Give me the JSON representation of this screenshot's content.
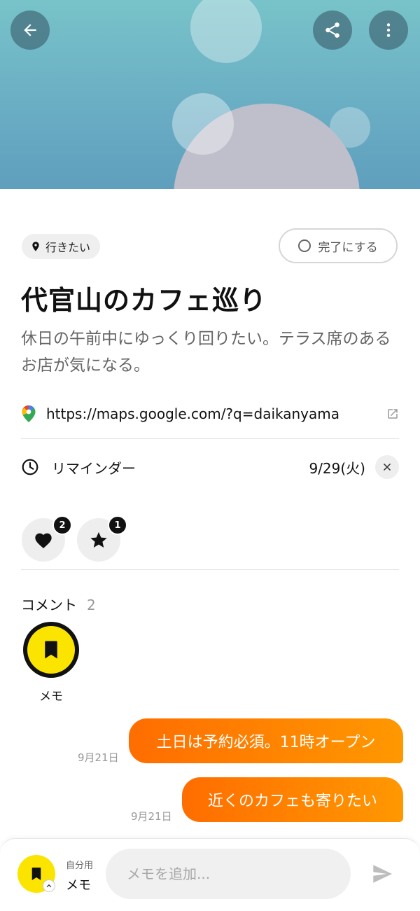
{
  "header": {
    "back_icon": "arrow-left-icon",
    "share_icon": "share-icon",
    "more_icon": "more-vertical-icon"
  },
  "status": {
    "tag_label": "行きたい",
    "tag_icon": "location-pin-icon",
    "complete_button": "完了にする"
  },
  "item": {
    "title": "代官山のカフェ巡り",
    "description": "休日の午前中にゆっくり回りたい。テラス席のあるお店が気になる。",
    "link_url": "https://maps.google.com/?q=daikanyama",
    "link_icon": "google-maps-pin-icon"
  },
  "reminder": {
    "label": "リマインダー",
    "date": "9/29(火)"
  },
  "reactions": [
    {
      "icon": "heart-icon",
      "count": "2"
    },
    {
      "icon": "star-icon",
      "count": "1"
    }
  ],
  "comments": {
    "heading": "コメント",
    "count": "2",
    "author": "メモ",
    "messages": [
      {
        "text": "土日は予約必須。11時オープン",
        "date": "9月21日"
      },
      {
        "text": "近くのカフェも寄りたい",
        "date": "9月21日"
      }
    ]
  },
  "composer": {
    "owner_sub": "自分用",
    "owner_name": "メモ",
    "placeholder": "メモを追加...",
    "send_icon": "send-icon"
  },
  "colors": {
    "accent_yellow": "#fbe400",
    "bubble_gradient_start": "#ff6d00",
    "bubble_gradient_end": "#ff9800"
  }
}
